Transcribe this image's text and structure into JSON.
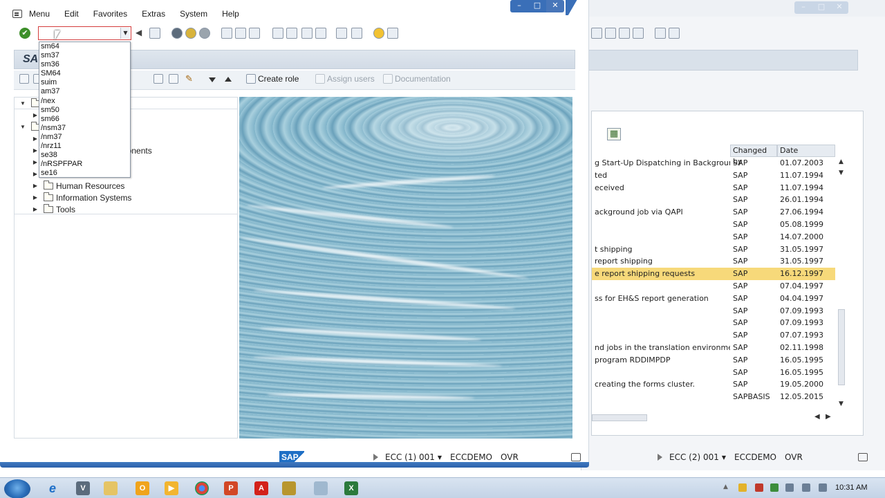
{
  "menubar": {
    "items": [
      "Menu",
      "Edit",
      "Favorites",
      "Extras",
      "System",
      "Help"
    ]
  },
  "command_field": {
    "value": ""
  },
  "dropdown": {
    "options": [
      "sm64",
      "sm37",
      "sm36",
      "SM64",
      "suim",
      "am37",
      "/nex",
      "sm50",
      "sm66",
      "/nsm37",
      "/nm37",
      "/nrz11",
      "se38",
      "/nRSPFPAR",
      "se16"
    ]
  },
  "header": {
    "logo_text": "SA"
  },
  "toolbar2": {
    "create_role": "Create role",
    "assign_users": "Assign users",
    "documentation": "Documentation",
    "partial_label": "u"
  },
  "tree": {
    "partial_text": "mponents",
    "nodes": [
      "Human Resources",
      "Information Systems",
      "Tools"
    ]
  },
  "statusbar_main": {
    "system": "ECC (1) 001",
    "user": "ECCDEMO",
    "mode": "OVR"
  },
  "statusbar_bg": {
    "system": "ECC (2) 001",
    "user": "ECCDEMO",
    "mode": "OVR"
  },
  "bg_table": {
    "columns": [
      "Changed by",
      "Date"
    ],
    "rows": [
      {
        "desc": "g Start-Up Dispatching in Background",
        "by": "SAP",
        "date": "01.07.2003"
      },
      {
        "desc": "ted",
        "by": "SAP",
        "date": "11.07.1994"
      },
      {
        "desc": "eceived",
        "by": "SAP",
        "date": "11.07.1994"
      },
      {
        "desc": "",
        "by": "SAP",
        "date": "26.01.1994"
      },
      {
        "desc": "ackground job via QAPI",
        "by": "SAP",
        "date": "27.06.1994"
      },
      {
        "desc": "",
        "by": "SAP",
        "date": "05.08.1999"
      },
      {
        "desc": "",
        "by": "SAP",
        "date": "14.07.2000"
      },
      {
        "desc": "t shipping",
        "by": "SAP",
        "date": "31.05.1997"
      },
      {
        "desc": "report shipping",
        "by": "SAP",
        "date": "31.05.1997"
      },
      {
        "desc": "e report shipping requests",
        "by": "SAP",
        "date": "16.12.1997"
      },
      {
        "desc": "",
        "by": "SAP",
        "date": "07.04.1997"
      },
      {
        "desc": "ss for EH&S report generation",
        "by": "SAP",
        "date": "04.04.1997"
      },
      {
        "desc": "",
        "by": "SAP",
        "date": "07.09.1993"
      },
      {
        "desc": "",
        "by": "SAP",
        "date": "07.09.1993"
      },
      {
        "desc": "",
        "by": "SAP",
        "date": "07.07.1993"
      },
      {
        "desc": "nd jobs in the translation environment",
        "by": "SAP",
        "date": "02.11.1998"
      },
      {
        "desc": "program RDDIMPDP",
        "by": "SAP",
        "date": "16.05.1995"
      },
      {
        "desc": "",
        "by": "SAP",
        "date": "16.05.1995"
      },
      {
        "desc": "creating the forms cluster.",
        "by": "SAP",
        "date": "19.05.2000"
      },
      {
        "desc": "",
        "by": "SAPBASIS",
        "date": "12.05.2015"
      }
    ],
    "selected_row": 9,
    "selected_color": "#f7d97a"
  },
  "sap_logo": "SAP",
  "taskbar": {
    "clock": "10:31 AM",
    "apps": [
      "ie-icon",
      "v-icon",
      "explorer-icon",
      "outlook-icon",
      "media-icon",
      "chrome-icon",
      "powerpoint-icon",
      "acrobat-icon",
      "sap-logon-icon",
      "notepad-icon",
      "excel-icon"
    ]
  },
  "colors": {
    "title_blue": "#3a6fb8",
    "ok_green": "#3d8f2a"
  }
}
